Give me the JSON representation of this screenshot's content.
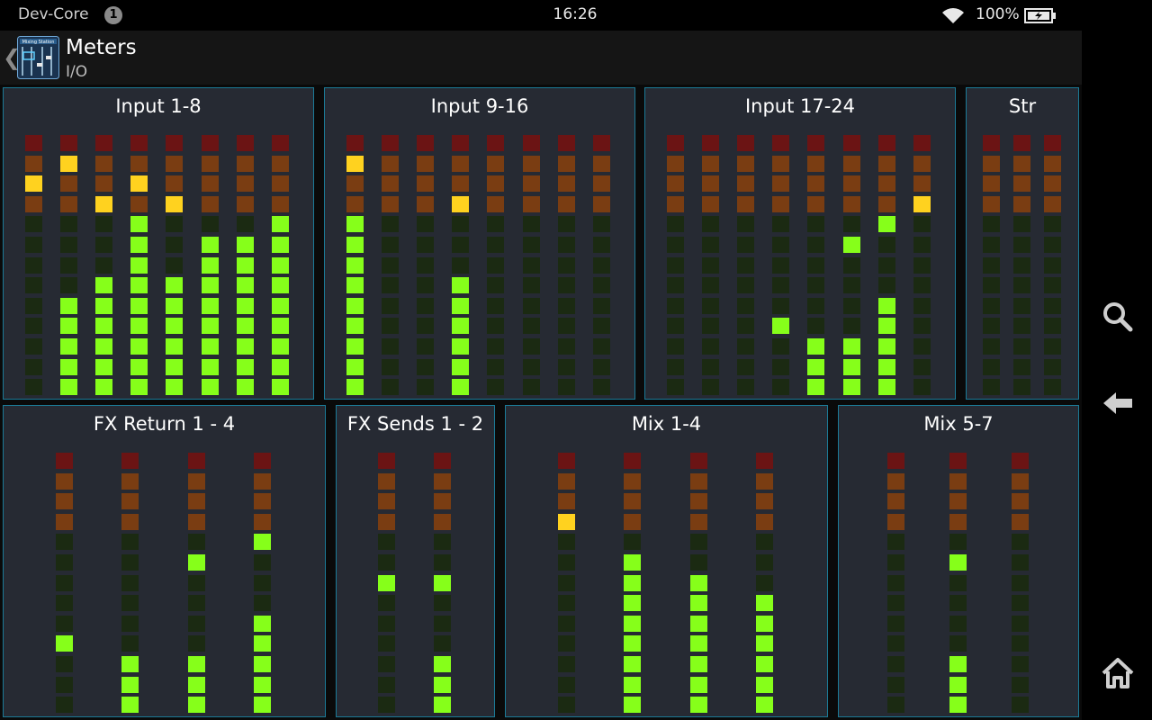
{
  "status_bar": {
    "carrier": "Dev-Core",
    "notification_count": "1",
    "time": "16:26",
    "battery_percent": "100%",
    "wifi_icon": "wifi-icon",
    "battery_icon": "battery-charging-icon"
  },
  "action_bar": {
    "back_glyph": "❮",
    "app_icon": "mixing-station-app-icon",
    "app_icon_label": "Mixing Station",
    "title": "Meters",
    "subtitle": "I/O"
  },
  "nav_bar": {
    "icons": [
      "search-icon",
      "back-arrow-icon",
      "home-icon"
    ]
  },
  "colors": {
    "clip_red": "#6b1414",
    "hot_orange": "#7a3d12",
    "peak_yellow": "#ffd21f",
    "signal_green": "#86ff1a",
    "unlit_green": "#1b2a12",
    "panel_bg": "#262a33",
    "panel_border": "#1b7a96"
  },
  "meter_scale": {
    "segments": 13,
    "note": "levels = number of lit segments from bottom (0-13)"
  },
  "panels": [
    {
      "id": "input-1-8",
      "title": "Input 1-8",
      "channels": [
        {
          "level": 0,
          "peak": 10
        },
        {
          "level": 5,
          "peak": 11
        },
        {
          "level": 6,
          "peak": 9
        },
        {
          "level": 9,
          "peak": 10
        },
        {
          "level": 6,
          "peak": 9
        },
        {
          "level": 8,
          "peak": null
        },
        {
          "level": 8,
          "peak": null
        },
        {
          "level": 9,
          "peak": null
        }
      ]
    },
    {
      "id": "input-9-16",
      "title": "Input 9-16",
      "channels": [
        {
          "level": 9,
          "peak": 11
        },
        {
          "level": 0,
          "peak": null
        },
        {
          "level": 0,
          "peak": null
        },
        {
          "level": 6,
          "peak": 9
        },
        {
          "level": 0,
          "peak": null
        },
        {
          "level": 0,
          "peak": null
        },
        {
          "level": 0,
          "peak": null
        },
        {
          "level": 0,
          "peak": null
        }
      ]
    },
    {
      "id": "input-17-24",
      "title": "Input 17-24",
      "channels": [
        {
          "level": 0,
          "peak": null
        },
        {
          "level": 0,
          "peak": null
        },
        {
          "level": 0,
          "peak": null
        },
        {
          "level": 0,
          "peak": 3
        },
        {
          "level": 3,
          "peak": null
        },
        {
          "level": 3,
          "peak": 7
        },
        {
          "level": 5,
          "peak": 8
        },
        {
          "level": 0,
          "peak": 9
        }
      ]
    },
    {
      "id": "str",
      "title": "Str",
      "channels": [
        {
          "level": 0,
          "peak": null
        },
        {
          "level": 0,
          "peak": null
        },
        {
          "level": 0,
          "peak": null
        }
      ]
    },
    {
      "id": "fx-return-1-4",
      "title": "FX Return 1 - 4",
      "channels": [
        {
          "level": 0,
          "peak": 3
        },
        {
          "level": 3,
          "peak": null
        },
        {
          "level": 3,
          "peak": 7
        },
        {
          "level": 5,
          "peak": 8
        }
      ]
    },
    {
      "id": "fx-sends-1-2",
      "title": "FX Sends 1 - 2",
      "channels": [
        {
          "level": 0,
          "peak": 6
        },
        {
          "level": 3,
          "peak": 6
        }
      ]
    },
    {
      "id": "mix-1-4",
      "title": "Mix 1-4",
      "channels": [
        {
          "level": 0,
          "peak": 9
        },
        {
          "level": 8,
          "peak": null
        },
        {
          "level": 7,
          "peak": null
        },
        {
          "level": 6,
          "peak": null
        }
      ]
    },
    {
      "id": "mix-5-7",
      "title": "Mix 5-7",
      "channels": [
        {
          "level": 0,
          "peak": null
        },
        {
          "level": 3,
          "peak": 7
        },
        {
          "level": 0,
          "peak": null
        }
      ]
    }
  ]
}
